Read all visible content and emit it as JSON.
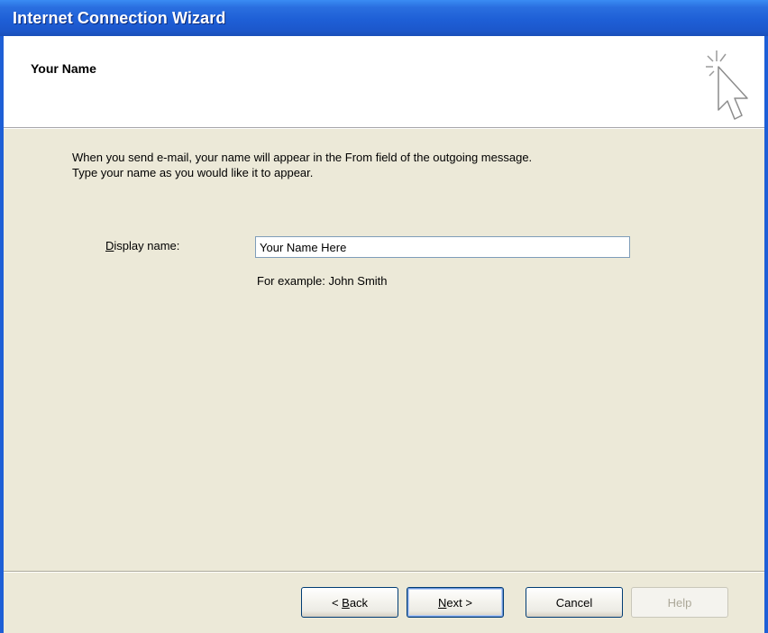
{
  "window": {
    "title": "Internet Connection Wizard"
  },
  "header": {
    "page_title": "Your Name",
    "icon": "wizard-cursor-sparkle-icon"
  },
  "intro": {
    "line1": "When you send e-mail, your name will appear in the From field of the outgoing message.",
    "line2": "Type your name as you would like it to appear."
  },
  "form": {
    "display_name": {
      "label_accel": "D",
      "label_rest": "isplay name:",
      "value": "Your Name Here"
    },
    "example": "For example: John Smith"
  },
  "buttons": {
    "back": {
      "prefix": "< ",
      "accel": "B",
      "rest": "ack"
    },
    "next": {
      "accel": "N",
      "rest": "ext >"
    },
    "cancel": "Cancel",
    "help": "Help"
  },
  "colors": {
    "titlebar": "#1e5fd6",
    "dialog_bg": "#ece9d8",
    "header_bg": "#ffffff",
    "input_border": "#7f9db9",
    "disabled_text": "#aca899"
  }
}
